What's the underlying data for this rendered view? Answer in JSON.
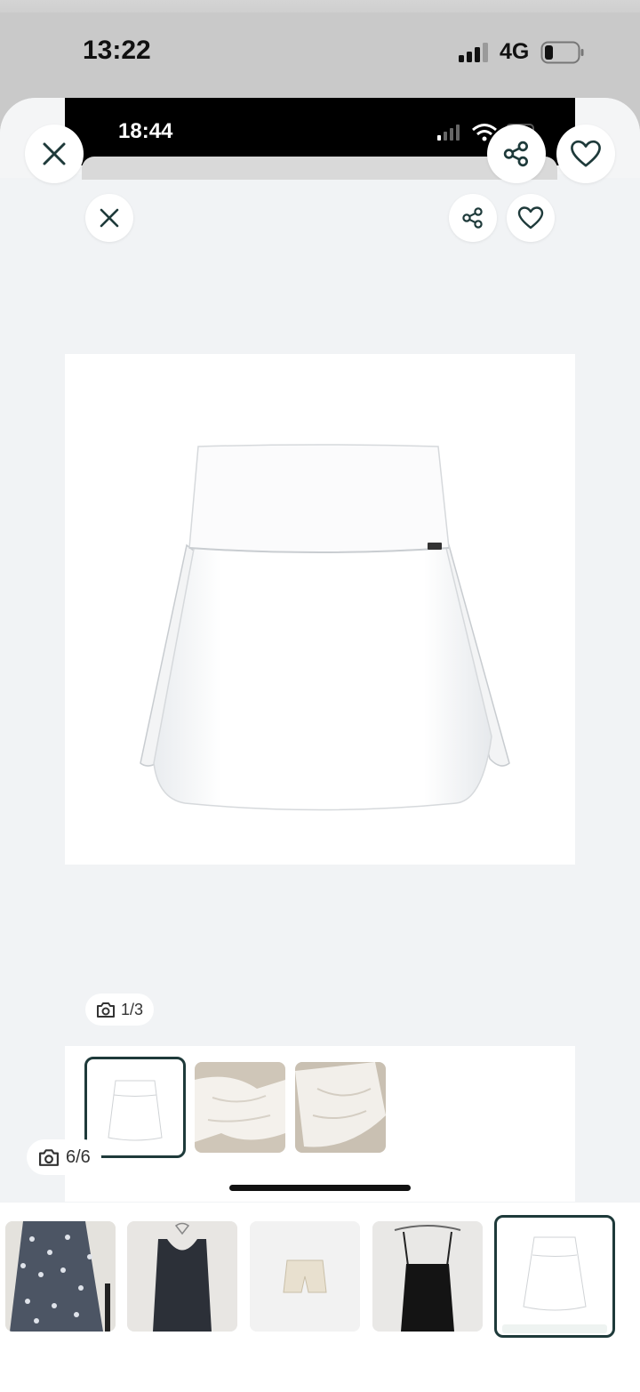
{
  "outer_status": {
    "time": "13:22",
    "network": "4G"
  },
  "inner_status": {
    "time": "18:44"
  },
  "inner_gallery": {
    "counter": "1/3"
  },
  "outer_gallery": {
    "counter": "6/6"
  },
  "icons": {
    "close": "close-icon",
    "share": "share-icon",
    "favorite": "heart-icon",
    "camera": "camera-icon"
  },
  "colors": {
    "accent": "#1e3a3a",
    "sheet_bg": "#f1f3f5"
  }
}
